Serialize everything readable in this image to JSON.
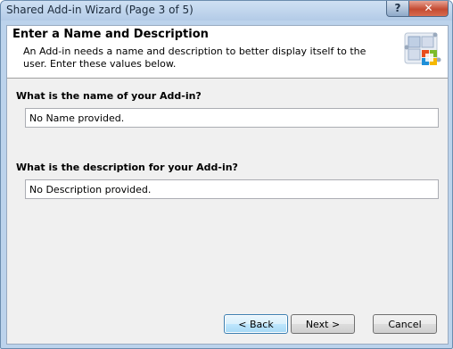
{
  "window": {
    "title": "Shared Add-in Wizard (Page 3 of 5)",
    "help_glyph": "?",
    "close_glyph": "✕"
  },
  "header": {
    "title": "Enter a Name and Description",
    "description": "An Add-in needs a name and description to better display itself to the user. Enter these values below.",
    "icon": "office-addin-puzzle-icon"
  },
  "form": {
    "name_question": "What is the name of your Add-in?",
    "name_value": "No Name provided.",
    "description_question": "What is the description for your Add-in?",
    "description_value": "No Description provided."
  },
  "buttons": {
    "back": "< Back",
    "next": "Next >",
    "cancel": "Cancel"
  },
  "colors": {
    "client_background": "#f0f0f0",
    "close_button": "#c44b32",
    "focused_button_border": "#3c7fb1"
  }
}
